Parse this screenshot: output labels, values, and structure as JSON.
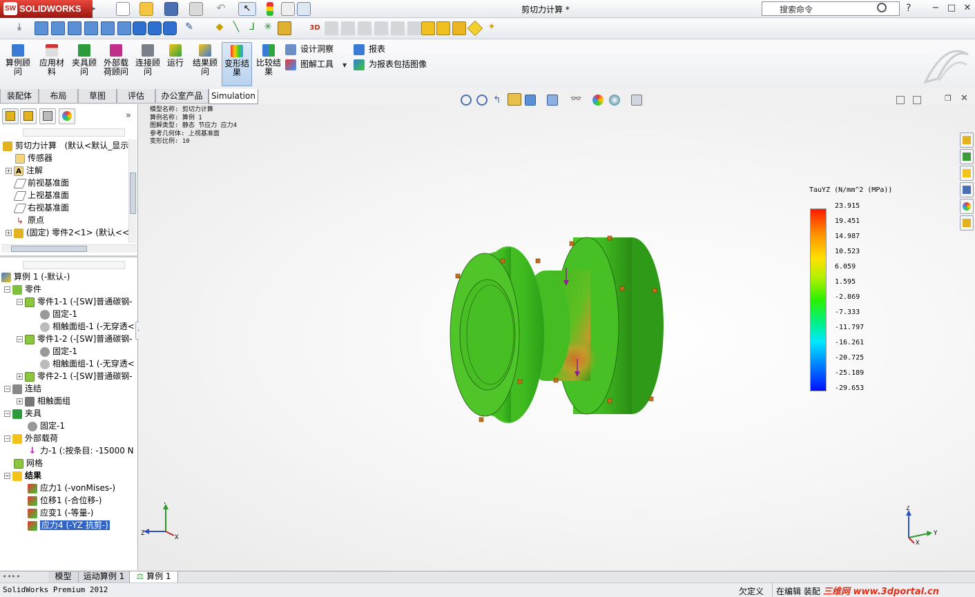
{
  "app": {
    "brand": "SOLIDWORKS",
    "brand_badge": "SW",
    "document_title": "剪切力计算 *",
    "search_placeholder": "搜索命令",
    "help_label": "?",
    "window_buttons": [
      "−",
      "□",
      "✕"
    ]
  },
  "command_manager": {
    "buttons": [
      {
        "label": "算例顾问",
        "icon": "study-advisor-icon"
      },
      {
        "label": "应用材料",
        "icon": "apply-material-icon"
      },
      {
        "label": "夹具顾问",
        "icon": "fixtures-advisor-icon"
      },
      {
        "label": "外部载荷顾问",
        "icon": "external-loads-icon"
      },
      {
        "label": "连接顾问",
        "icon": "connections-advisor-icon"
      },
      {
        "label": "运行",
        "icon": "run-icon"
      },
      {
        "label": "结果顾问",
        "icon": "results-advisor-icon"
      },
      {
        "label": "变形结果",
        "icon": "deformed-result-icon"
      },
      {
        "label": "比较结果",
        "icon": "compare-results-icon"
      }
    ],
    "side_items": [
      {
        "label": "设计洞察",
        "icon": "design-insight-icon"
      },
      {
        "label": "图解工具",
        "icon": "plot-tools-icon"
      },
      {
        "label": "报表",
        "icon": "report-icon"
      },
      {
        "label": "为报表包括图像",
        "icon": "include-image-icon"
      }
    ],
    "tabs": [
      "装配体",
      "布局",
      "草图",
      "评估",
      "办公室产品",
      "Simulation"
    ],
    "active_tab": "Simulation"
  },
  "feature_tree": {
    "root": "剪切力计算",
    "root_suffix": "(默认<默认_显示",
    "items": [
      {
        "label": "传感器",
        "icon": "sensor-icon"
      },
      {
        "label": "注解",
        "icon": "annotation-icon"
      },
      {
        "label": "前视基准面",
        "icon": "plane-icon"
      },
      {
        "label": "上视基准面",
        "icon": "plane-icon"
      },
      {
        "label": "右视基准面",
        "icon": "plane-icon"
      },
      {
        "label": "原点",
        "icon": "origin-icon"
      },
      {
        "label": "(固定) 零件2<1> (默认<<",
        "icon": "part-icon"
      }
    ]
  },
  "study_tree": {
    "study": "算例 1 (-默认-)",
    "items": [
      {
        "label": "零件",
        "bold": false
      },
      {
        "label": "零件1-1 (-[SW]普通碳钢-",
        "bold": false
      },
      {
        "label": "固定-1",
        "bold": false
      },
      {
        "label": "相触面组-1 (-无穿透<",
        "bold": false
      },
      {
        "label": "零件1-2 (-[SW]普通碳钢-",
        "bold": false
      },
      {
        "label": "固定-1",
        "bold": false
      },
      {
        "label": "相触面组-1 (-无穿透<",
        "bold": false
      },
      {
        "label": "零件2-1 (-[SW]普通碳钢-",
        "bold": false
      },
      {
        "label": "连结",
        "bold": false
      },
      {
        "label": "相触面组",
        "bold": false
      },
      {
        "label": "夹具",
        "bold": false
      },
      {
        "label": "固定-1",
        "bold": false
      },
      {
        "label": "外部载荷",
        "bold": false
      },
      {
        "label": "力-1 (:按条目: -15000 N",
        "bold": false
      },
      {
        "label": "网格",
        "bold": false
      },
      {
        "label": "结果",
        "bold": true
      },
      {
        "label": "应力1 (-vonMises-)",
        "bold": false
      },
      {
        "label": "位移1 (-合位移-)",
        "bold": false
      },
      {
        "label": "应变1 (-等量-)",
        "bold": false
      },
      {
        "label": "应力4 (-YZ 抗剪-)",
        "bold": false,
        "selected": true
      }
    ]
  },
  "plot_info": [
    "模型名称: 剪切力计算",
    "算例名称: 算例 1",
    "图解类型: 静态 节应力 应力4",
    "参考几何体: 上视基准面",
    "变形比例: 10"
  ],
  "legend": {
    "title": "TauYZ (N/mm^2 (MPa))",
    "values": [
      "23.915",
      "19.451",
      "14.987",
      "10.523",
      "6.059",
      "1.595",
      "-2.869",
      "-7.333",
      "-11.797",
      "-16.261",
      "-20.725",
      "-25.189",
      "-29.653"
    ],
    "colors": {
      "max": "#ff1a00",
      "mid": "#2bf000",
      "min": "#0010ff"
    }
  },
  "triad": {
    "x": "X",
    "y": "Y",
    "z": "Z"
  },
  "bottom_tabs": [
    "模型",
    "运动算例 1",
    "算例 1"
  ],
  "status": {
    "product": "SolidWorks Premium 2012",
    "underdefined": "欠定义",
    "editing": "在编辑 装配",
    "watermark": "三维网 www.3dportal.cn"
  }
}
